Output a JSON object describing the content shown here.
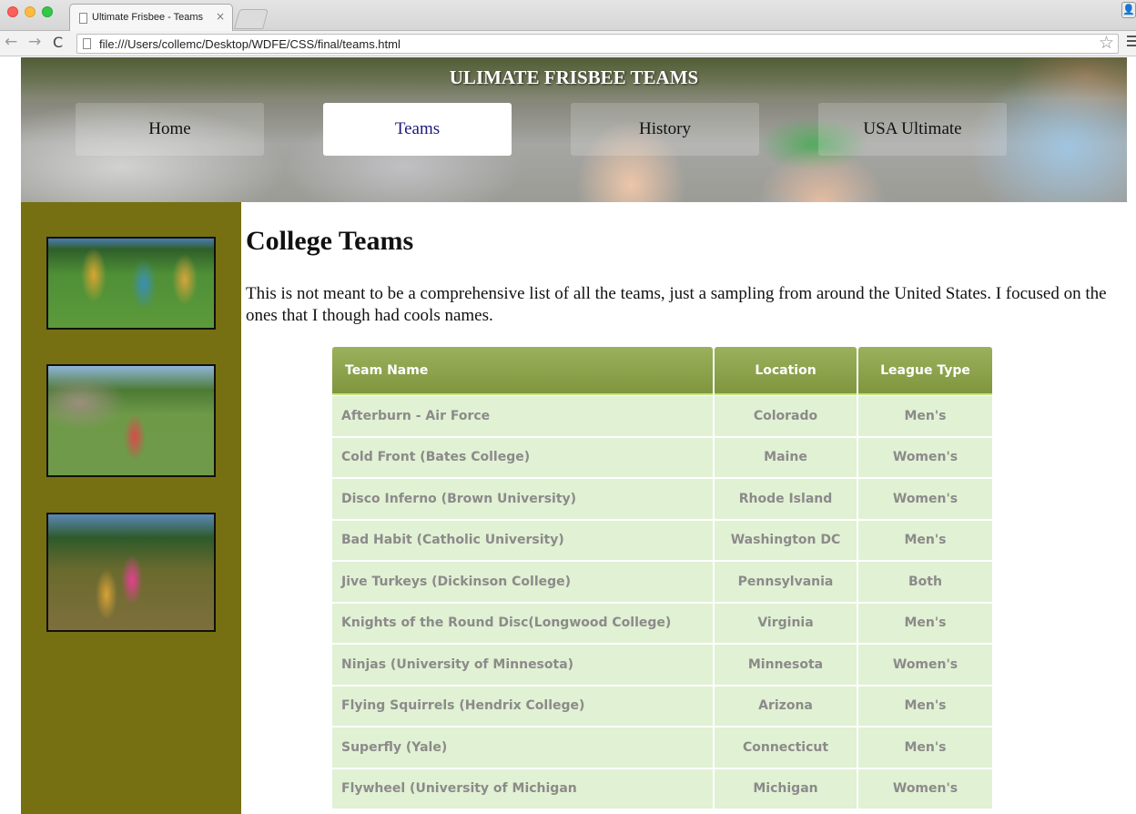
{
  "browser": {
    "tab_title": "Ultimate Frisbee - Teams",
    "tab_close": "×",
    "url": "file:///Users/collemc/Desktop/WDFE/CSS/final/teams.html",
    "back": "←",
    "forward": "→",
    "reload": "C",
    "star": "☆",
    "profile": "👤"
  },
  "header": {
    "site_title": "ULIMATE FRISBEE TEAMS",
    "nav": [
      {
        "label": "Home",
        "active": false
      },
      {
        "label": "Teams",
        "active": true
      },
      {
        "label": "History",
        "active": false
      },
      {
        "label": "USA Ultimate",
        "active": false
      }
    ]
  },
  "main": {
    "heading": "College Teams",
    "intro": "This is not meant to be a comprehensive list of all the teams, just a sampling from around the United States. I focused on the ones that I though had cools names."
  },
  "table": {
    "headers": [
      "Team Name",
      "Location",
      "League Type"
    ],
    "rows": [
      [
        "Afterburn - Air Force",
        "Colorado",
        "Men's"
      ],
      [
        "Cold Front (Bates College)",
        "Maine",
        "Women's"
      ],
      [
        "Disco Inferno (Brown University)",
        "Rhode Island",
        "Women's"
      ],
      [
        "Bad Habit (Catholic University)",
        "Washington DC",
        "Men's"
      ],
      [
        "Jive Turkeys (Dickinson College)",
        "Pennsylvania",
        "Both"
      ],
      [
        "Knights of the Round Disc(Longwood College)",
        "Virginia",
        "Men's"
      ],
      [
        "Ninjas (University of Minnesota)",
        "Minnesota",
        "Women's"
      ],
      [
        "Flying Squirrels (Hendrix College)",
        "Arizona",
        "Men's"
      ],
      [
        "Superfly (Yale)",
        "Connecticut",
        "Men's"
      ],
      [
        "Flywheel (University of Michigan",
        "Michigan",
        "Women's"
      ]
    ]
  },
  "colors": {
    "sidebar": "#767012",
    "table_header": "#8aa04a",
    "table_row": "#e1f1d4",
    "table_text": "#8c8a8a",
    "active_nav_text": "#1a1a7a"
  }
}
